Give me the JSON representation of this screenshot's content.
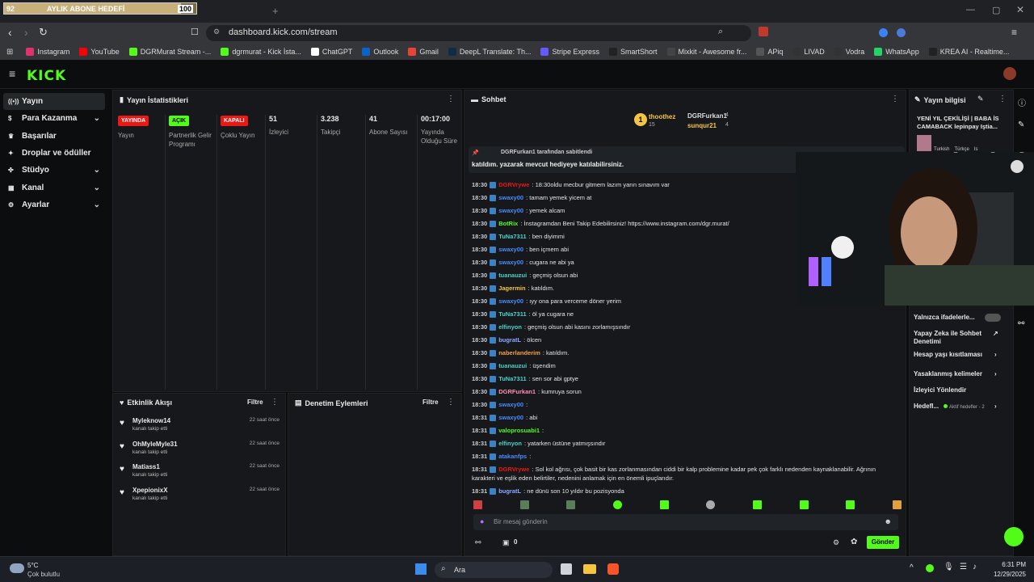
{
  "goal": {
    "count": "92",
    "label": "AYLIK ABONE HEDEFİ",
    "target": "100",
    "progress": 0.92
  },
  "browser": {
    "url": "dashboard.kick.com/stream"
  },
  "bookmarks": [
    {
      "label": "Instagram",
      "color": "#e1306c"
    },
    {
      "label": "YouTube",
      "color": "#ff0000"
    },
    {
      "label": "DGRMurat Stream -...",
      "color": "#53fc18"
    },
    {
      "label": "dgrmurat - Kick İsta...",
      "color": "#53fc18"
    },
    {
      "label": "ChatGPT",
      "color": "#ffffff"
    },
    {
      "label": "Outlook",
      "color": "#0a64c8"
    },
    {
      "label": "Gmail",
      "color": "#ea4335"
    },
    {
      "label": "DeepL Translate: Th...",
      "color": "#0f2b46"
    },
    {
      "label": "Stripe Express",
      "color": "#635bff"
    },
    {
      "label": "SmartShort",
      "color": "#222222"
    },
    {
      "label": "Mixkit - Awesome fr...",
      "color": "#444444"
    },
    {
      "label": "APiq",
      "color": "#555555"
    },
    {
      "label": "LIVAD",
      "color": "#333333"
    },
    {
      "label": "Vodra",
      "color": "#333333"
    },
    {
      "label": "WhatsApp",
      "color": "#25d366"
    },
    {
      "label": "KREA AI - Realtime...",
      "color": "#222222"
    }
  ],
  "brand": {
    "logo": "KICK",
    "accent": "#53fc18"
  },
  "sidebar": [
    {
      "label": "Yayın",
      "icon": "broadcast-icon",
      "active": true,
      "chevron": false
    },
    {
      "label": "Para Kazanma",
      "icon": "money-icon",
      "active": false,
      "chevron": true
    },
    {
      "label": "Başarılar",
      "icon": "trophy-icon",
      "active": false,
      "chevron": false
    },
    {
      "label": "Droplar ve ödüller",
      "icon": "gift-icon",
      "active": false,
      "chevron": false
    },
    {
      "label": "Stüdyo",
      "icon": "studio-icon",
      "active": false,
      "chevron": true
    },
    {
      "label": "Kanal",
      "icon": "channel-icon",
      "active": false,
      "chevron": true
    },
    {
      "label": "Ayarlar",
      "icon": "settings-icon",
      "active": false,
      "chevron": true
    }
  ],
  "stats": {
    "title": "Yayın İstatistikleri",
    "cols": [
      {
        "badge": "YAYINDA",
        "badge_color": "#e91916",
        "label": "Yayın"
      },
      {
        "badge": "AÇIK",
        "badge_color": "#53fc18",
        "label": "Partnerlik Gelir Programı"
      },
      {
        "badge": "KAPALI",
        "badge_color": "#e91916",
        "label": "Çoklu Yayın"
      },
      {
        "value": "51",
        "label": "İzleyici"
      },
      {
        "value": "3.238",
        "label": "Takipçi"
      },
      {
        "value": "41",
        "label": "Abone Sayısı"
      },
      {
        "value": "00:17:00",
        "label": "Yayında Olduğu Süre"
      }
    ]
  },
  "activity": {
    "title": "Etkinlik Akışı",
    "filter": "Filtre",
    "items": [
      {
        "name": "Myleknow14",
        "sub": "kanalı takip etti",
        "time": "22 saat önce"
      },
      {
        "name": "OhMyleMyle31",
        "sub": "kanalı takip etti",
        "time": "22 saat önce"
      },
      {
        "name": "Matiass1",
        "sub": "kanalı takip etti",
        "time": "22 saat önce"
      },
      {
        "name": "XpepionixX",
        "sub": "kanalı takip etti",
        "time": "22 saat önce"
      }
    ]
  },
  "moderation": {
    "title": "Denetim Eylemleri",
    "filter": "Filtre"
  },
  "chat": {
    "title": "Sohbet",
    "top_gifters": [
      {
        "rank": "1",
        "name": "thoothez",
        "count": "15"
      },
      {
        "name": "DGRFurkan1",
        "count": "4"
      },
      {
        "name": "sunqur21",
        "count": "4"
      }
    ],
    "pinned": {
      "by": "DGRFurkan1 tarafından sabitlendi",
      "text": "katıldım. yazarak mevcut hediyeye katılabilirsiniz."
    },
    "messages": [
      {
        "time": "18:30",
        "user": "DGRVrywe",
        "color": "#e91916",
        "text": ": 18:30oldu mecbur gitmem lazım yarın sınavım var"
      },
      {
        "time": "18:30",
        "user": "swaxy00",
        "color": "#4a8cff",
        "text": ": tamam yemek yicem at"
      },
      {
        "time": "18:30",
        "user": "swaxy00",
        "color": "#4a8cff",
        "text": ": yemek alcam"
      },
      {
        "time": "18:30",
        "user": "BotRix",
        "color": "#53fc18",
        "text": ": İnstagramdan Beni Takip Edebilirsiniz! https://www.instagram.com/dgr.murat/"
      },
      {
        "time": "18:30",
        "user": "TuNa7311",
        "color": "#4ad3c8",
        "text": ": ben diyimmi"
      },
      {
        "time": "18:30",
        "user": "swaxy00",
        "color": "#4a8cff",
        "text": ": ben içmem abi"
      },
      {
        "time": "18:30",
        "user": "swaxy00",
        "color": "#4a8cff",
        "text": ": cugara ne abi ya"
      },
      {
        "time": "18:30",
        "user": "tuanauzui",
        "color": "#4ad3c8",
        "text": ": geçmiş olsun abi"
      },
      {
        "time": "18:30",
        "user": "Jagermin",
        "color": "#f5c542",
        "text": ": katıldım."
      },
      {
        "time": "18:30",
        "user": "swaxy00",
        "color": "#4a8cff",
        "text": ": ıyy ona para verceme döner yerim"
      },
      {
        "time": "18:30",
        "user": "TuNa7311",
        "color": "#4ad3c8",
        "text": ": öl ya cugara ne"
      },
      {
        "time": "18:30",
        "user": "elfinyon",
        "color": "#4ad3c8",
        "text": ": geçmiş olsun abi kasını zorlamışsındır"
      },
      {
        "time": "18:30",
        "user": "bugratL",
        "color": "#8fa8ff",
        "text": ": ölcen"
      },
      {
        "time": "18:30",
        "user": "naberlanderim",
        "color": "#f5a142",
        "text": ": katıldım."
      },
      {
        "time": "18:30",
        "user": "tuanauzui",
        "color": "#4ad3c8",
        "text": ": üşendim"
      },
      {
        "time": "18:30",
        "user": "TuNa7311",
        "color": "#4ad3c8",
        "text": ": sen sor abi gptye"
      },
      {
        "time": "18:30",
        "user": "DGRFurkan1",
        "color": "#ff8fb0",
        "text": ": kumruya sorun"
      },
      {
        "time": "18:30",
        "user": "swaxy00",
        "color": "#4a8cff",
        "text": ":"
      },
      {
        "time": "18:31",
        "user": "swaxy00",
        "color": "#4a8cff",
        "text": ": abi"
      },
      {
        "time": "18:31",
        "user": "valoprosuabi1",
        "color": "#53fc18",
        "text": ":"
      },
      {
        "time": "18:31",
        "user": "elfinyon",
        "color": "#4ad3c8",
        "text": ": yatarken üstüne yatmışsındır"
      },
      {
        "time": "18:31",
        "user": "atakanfps",
        "color": "#4a8cff",
        "text": ":"
      },
      {
        "time": "18:31",
        "user": "DGRVrywe",
        "color": "#e91916",
        "text": ": Sol kol ağrısı, çok basit bir kas zorlanmasından ciddi bir kalp problemine kadar pek çok farklı nedenden kaynaklanabilir. Ağrının"
      },
      {
        "time": "",
        "user": "",
        "color": "#e6e6e6",
        "text": "karakteri ve eşlik eden belirtiler, nedenini anlamak için en önemli ipuçlarıdır."
      },
      {
        "time": "18:31",
        "user": "bugratL",
        "color": "#8fa8ff",
        "text": ": ne dünü son 10 yıldır bu pozisyonda"
      }
    ],
    "input_placeholder": "Bir mesaj gönderin",
    "send_label": "Gönder",
    "count": "0"
  },
  "stream_info": {
    "title": "Yayın bilgisi",
    "stream_title": "YENİ YIL ÇEKİLİŞİ | BABA İS CAMABACK lepinpay Iştia...",
    "overlay_brand": "epinpay",
    "tags": [
      "Turkish",
      "Türkçe",
      "Is"
    ]
  },
  "settings": [
    {
      "label": "Yalnızca ifadelerle...",
      "kind": "toggle"
    },
    {
      "label": "Yapay Zeka ile Sohbet Denetimi",
      "kind": "link"
    },
    {
      "label": "Hesap yaşı kısıtlaması",
      "kind": "chevron"
    },
    {
      "label": "Yasaklanmış kelimeler",
      "kind": "chevron"
    },
    {
      "label": "İzleyici Yönlendir",
      "kind": "none"
    },
    {
      "label": "Hedefl...",
      "kind": "goal",
      "extra": "Aktif hedefler - 2"
    }
  ],
  "taskbar": {
    "weather_temp": "5°C",
    "weather_desc": "Çok bulutlu",
    "search": "Ara",
    "time": "6:31 PM",
    "date": "12/29/2025"
  }
}
